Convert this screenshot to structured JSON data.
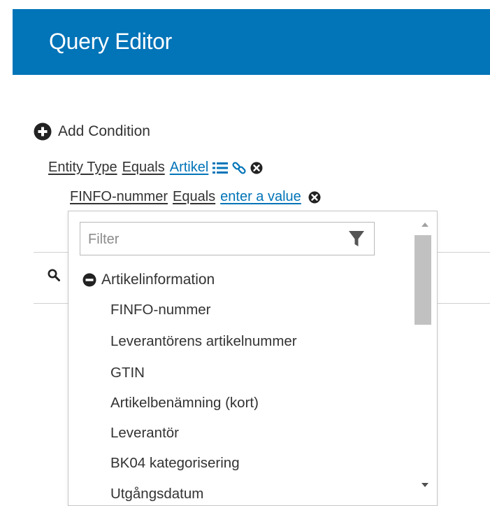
{
  "header": {
    "title": "Query Editor"
  },
  "add_condition": {
    "label": "Add Condition",
    "icon": "plus-circle-icon"
  },
  "condition1": {
    "field": "Entity Type",
    "operator": "Equals",
    "value": "Artikel",
    "icons": [
      "list-icon",
      "link-icon",
      "remove-icon"
    ]
  },
  "condition2": {
    "field": "FINFO-nummer",
    "operator": "Equals",
    "value": "enter a value",
    "icons": [
      "remove-icon"
    ]
  },
  "dropdown": {
    "filter_placeholder": "Filter",
    "filter_icon": "funnel-icon",
    "group": {
      "label": "Artikelinformation",
      "icon": "minus-circle-icon"
    },
    "options": [
      "FINFO-nummer",
      "Leverantörens artikelnummer",
      "GTIN",
      "Artikelbenämning (kort)",
      "Leverantör",
      "BK04 kategorisering",
      "Utgångsdatum"
    ]
  },
  "background_search_icon": "search-icon",
  "colors": {
    "header_bg": "#0274b8",
    "link": "#0274b8",
    "text": "#333333"
  }
}
